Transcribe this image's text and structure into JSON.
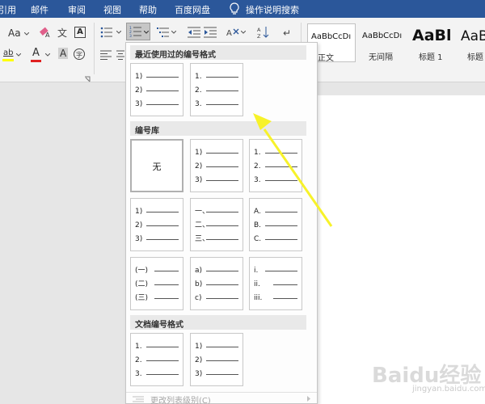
{
  "menubar": {
    "items": [
      "引用",
      "邮件",
      "审阅",
      "视图",
      "帮助",
      "百度网盘"
    ],
    "search_label": "操作说明搜索"
  },
  "ribbon": {
    "font_size_label": "Aa",
    "text_highlight_label": "ab",
    "font_color_label": "A",
    "char_shade_label": "A",
    "char_border_label": "A",
    "phonetic_label": "文",
    "styles": [
      {
        "sample": "AaBbCcDı",
        "name": "正文"
      },
      {
        "sample": "AaBbCcDı",
        "name": "无间隔"
      },
      {
        "sample": "AaBl",
        "name": "标题 1"
      },
      {
        "sample": "AaB",
        "name": "标题"
      }
    ]
  },
  "panel": {
    "sections": {
      "recent": "最近使用过的编号格式",
      "library": "编号库",
      "document": "文档编号格式"
    },
    "recent_tiles": [
      [
        "1)",
        "2)",
        "3)"
      ],
      [
        "1.",
        "2.",
        "3."
      ]
    ],
    "none_label": "无",
    "library_tiles": [
      [
        "1)",
        "2)",
        "3)"
      ],
      [
        "1.",
        "2.",
        "3."
      ],
      [
        "1)",
        "2)",
        "3)"
      ],
      [
        "一、",
        "二、",
        "三、"
      ],
      [
        "A.",
        "B.",
        "C."
      ],
      [
        "(一)",
        "(二)",
        "(三)"
      ],
      [
        "a)",
        "b)",
        "c)"
      ],
      [
        "i.",
        "ii.",
        "iii."
      ]
    ],
    "document_tiles": [
      [
        "1.",
        "2.",
        "3."
      ],
      [
        "1)",
        "2)",
        "3)"
      ]
    ],
    "footer_label": "更改列表级别(C)"
  },
  "watermark": {
    "text": "Baidu经验",
    "sub": "jingyan.baidu.com"
  },
  "colors": {
    "menubar_bg": "#2b579a",
    "arrow": "#f7f22a"
  }
}
